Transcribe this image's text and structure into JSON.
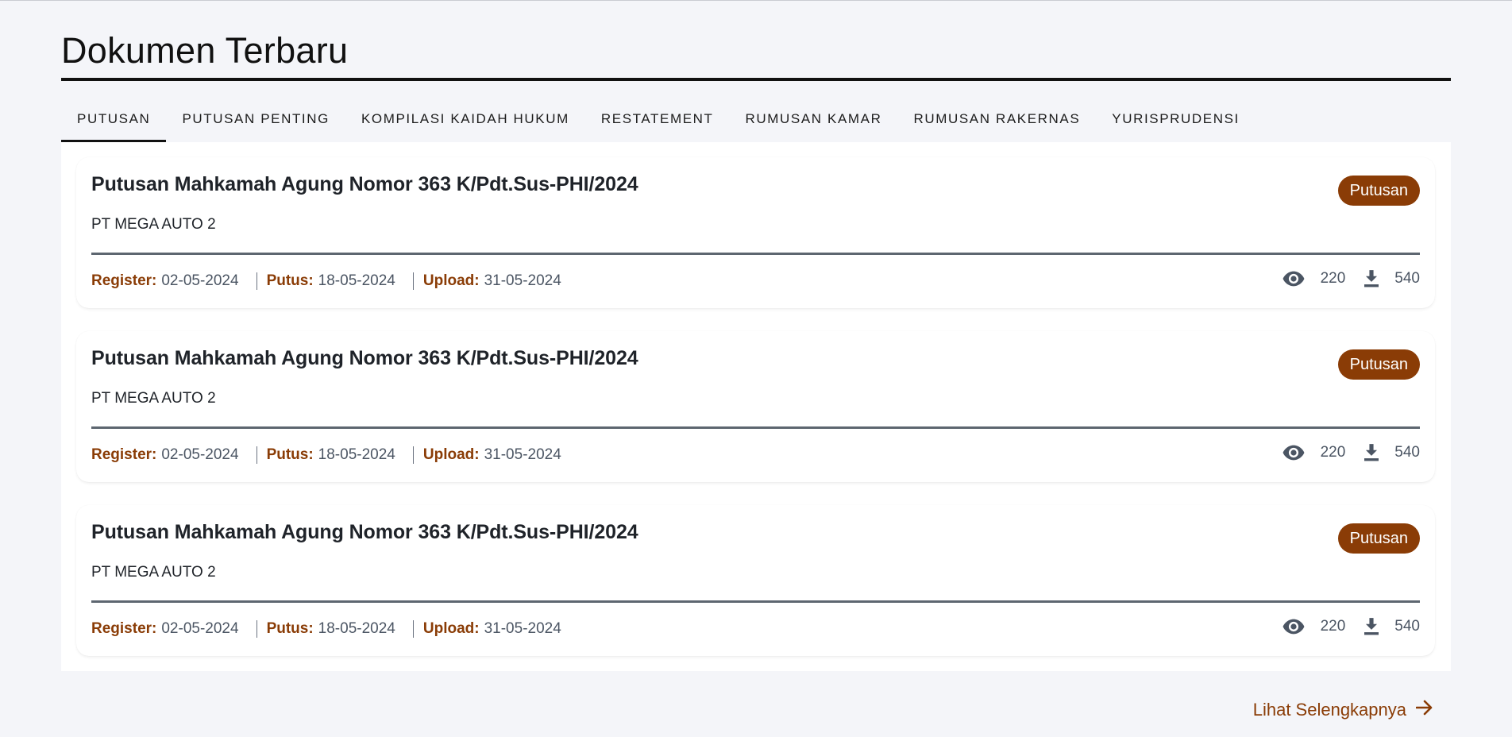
{
  "section": {
    "title": "Dokumen Terbaru",
    "more_label": "Lihat Selengkapnya"
  },
  "tabs": [
    {
      "label": "PUTUSAN",
      "active": true
    },
    {
      "label": "PUTUSAN PENTING",
      "active": false
    },
    {
      "label": "KOMPILASI KAIDAH HUKUM",
      "active": false
    },
    {
      "label": "RESTATEMENT",
      "active": false
    },
    {
      "label": "RUMUSAN KAMAR",
      "active": false
    },
    {
      "label": "RUMUSAN RAKERNAS",
      "active": false
    },
    {
      "label": "YURISPRUDENSI",
      "active": false
    }
  ],
  "cards": [
    {
      "title": "Putusan Mahkamah Agung Nomor 363 K/Pdt.Sus-PHI/2024",
      "subtitle": "PT MEGA AUTO 2",
      "badge": "Putusan",
      "register_label": "Register:",
      "register_date": "02-05-2024",
      "putus_label": "Putus:",
      "putus_date": "18-05-2024",
      "upload_label": "Upload:",
      "upload_date": "31-05-2024",
      "views": "220",
      "downloads": "540"
    },
    {
      "title": "Putusan Mahkamah Agung Nomor 363 K/Pdt.Sus-PHI/2024",
      "subtitle": "PT MEGA AUTO 2",
      "badge": "Putusan",
      "register_label": "Register:",
      "register_date": "02-05-2024",
      "putus_label": "Putus:",
      "putus_date": "18-05-2024",
      "upload_label": "Upload:",
      "upload_date": "31-05-2024",
      "views": "220",
      "downloads": "540"
    },
    {
      "title": "Putusan Mahkamah Agung Nomor 363 K/Pdt.Sus-PHI/2024",
      "subtitle": "PT MEGA AUTO 2",
      "badge": "Putusan",
      "register_label": "Register:",
      "register_date": "02-05-2024",
      "putus_label": "Putus:",
      "putus_date": "18-05-2024",
      "upload_label": "Upload:",
      "upload_date": "31-05-2024",
      "views": "220",
      "downloads": "540"
    }
  ],
  "colors": {
    "accent": "#8a3c06",
    "text": "#1f2329",
    "muted": "#4b5563",
    "background": "#f4f5f9"
  },
  "icons": {
    "views": "eye-icon",
    "downloads": "download-icon",
    "more": "arrow-right-icon"
  }
}
